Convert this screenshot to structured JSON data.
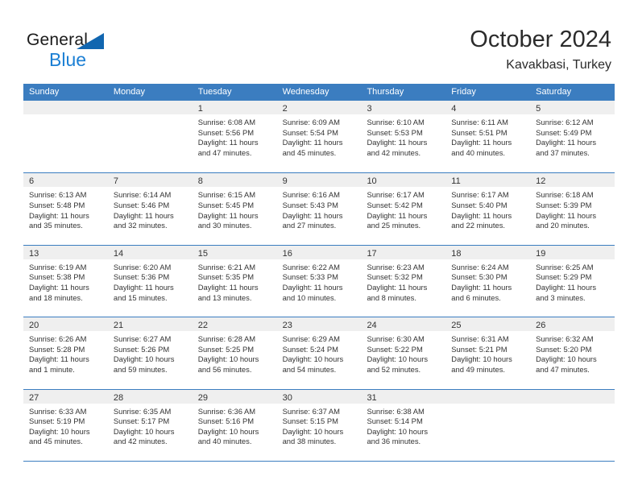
{
  "brand": {
    "word_one": "General",
    "word_two": "Blue",
    "triangle_color": "#1166b0",
    "blue_text_color": "#1b7fd4"
  },
  "header": {
    "title": "October 2024",
    "subtitle": "Kavakbasi, Turkey"
  },
  "theme": {
    "header_bar_color": "#3b7dc0",
    "day_band_color": "#efefef",
    "text_color": "#333333"
  },
  "calendar": {
    "weekdays": [
      "Sunday",
      "Monday",
      "Tuesday",
      "Wednesday",
      "Thursday",
      "Friday",
      "Saturday"
    ],
    "weeks": [
      [
        {
          "day": "",
          "sunrise": "",
          "sunset": "",
          "daylight_line1": "",
          "daylight_line2": ""
        },
        {
          "day": "",
          "sunrise": "",
          "sunset": "",
          "daylight_line1": "",
          "daylight_line2": ""
        },
        {
          "day": "1",
          "sunrise": "Sunrise: 6:08 AM",
          "sunset": "Sunset: 5:56 PM",
          "daylight_line1": "Daylight: 11 hours",
          "daylight_line2": "and 47 minutes."
        },
        {
          "day": "2",
          "sunrise": "Sunrise: 6:09 AM",
          "sunset": "Sunset: 5:54 PM",
          "daylight_line1": "Daylight: 11 hours",
          "daylight_line2": "and 45 minutes."
        },
        {
          "day": "3",
          "sunrise": "Sunrise: 6:10 AM",
          "sunset": "Sunset: 5:53 PM",
          "daylight_line1": "Daylight: 11 hours",
          "daylight_line2": "and 42 minutes."
        },
        {
          "day": "4",
          "sunrise": "Sunrise: 6:11 AM",
          "sunset": "Sunset: 5:51 PM",
          "daylight_line1": "Daylight: 11 hours",
          "daylight_line2": "and 40 minutes."
        },
        {
          "day": "5",
          "sunrise": "Sunrise: 6:12 AM",
          "sunset": "Sunset: 5:49 PM",
          "daylight_line1": "Daylight: 11 hours",
          "daylight_line2": "and 37 minutes."
        }
      ],
      [
        {
          "day": "6",
          "sunrise": "Sunrise: 6:13 AM",
          "sunset": "Sunset: 5:48 PM",
          "daylight_line1": "Daylight: 11 hours",
          "daylight_line2": "and 35 minutes."
        },
        {
          "day": "7",
          "sunrise": "Sunrise: 6:14 AM",
          "sunset": "Sunset: 5:46 PM",
          "daylight_line1": "Daylight: 11 hours",
          "daylight_line2": "and 32 minutes."
        },
        {
          "day": "8",
          "sunrise": "Sunrise: 6:15 AM",
          "sunset": "Sunset: 5:45 PM",
          "daylight_line1": "Daylight: 11 hours",
          "daylight_line2": "and 30 minutes."
        },
        {
          "day": "9",
          "sunrise": "Sunrise: 6:16 AM",
          "sunset": "Sunset: 5:43 PM",
          "daylight_line1": "Daylight: 11 hours",
          "daylight_line2": "and 27 minutes."
        },
        {
          "day": "10",
          "sunrise": "Sunrise: 6:17 AM",
          "sunset": "Sunset: 5:42 PM",
          "daylight_line1": "Daylight: 11 hours",
          "daylight_line2": "and 25 minutes."
        },
        {
          "day": "11",
          "sunrise": "Sunrise: 6:17 AM",
          "sunset": "Sunset: 5:40 PM",
          "daylight_line1": "Daylight: 11 hours",
          "daylight_line2": "and 22 minutes."
        },
        {
          "day": "12",
          "sunrise": "Sunrise: 6:18 AM",
          "sunset": "Sunset: 5:39 PM",
          "daylight_line1": "Daylight: 11 hours",
          "daylight_line2": "and 20 minutes."
        }
      ],
      [
        {
          "day": "13",
          "sunrise": "Sunrise: 6:19 AM",
          "sunset": "Sunset: 5:38 PM",
          "daylight_line1": "Daylight: 11 hours",
          "daylight_line2": "and 18 minutes."
        },
        {
          "day": "14",
          "sunrise": "Sunrise: 6:20 AM",
          "sunset": "Sunset: 5:36 PM",
          "daylight_line1": "Daylight: 11 hours",
          "daylight_line2": "and 15 minutes."
        },
        {
          "day": "15",
          "sunrise": "Sunrise: 6:21 AM",
          "sunset": "Sunset: 5:35 PM",
          "daylight_line1": "Daylight: 11 hours",
          "daylight_line2": "and 13 minutes."
        },
        {
          "day": "16",
          "sunrise": "Sunrise: 6:22 AM",
          "sunset": "Sunset: 5:33 PM",
          "daylight_line1": "Daylight: 11 hours",
          "daylight_line2": "and 10 minutes."
        },
        {
          "day": "17",
          "sunrise": "Sunrise: 6:23 AM",
          "sunset": "Sunset: 5:32 PM",
          "daylight_line1": "Daylight: 11 hours",
          "daylight_line2": "and 8 minutes."
        },
        {
          "day": "18",
          "sunrise": "Sunrise: 6:24 AM",
          "sunset": "Sunset: 5:30 PM",
          "daylight_line1": "Daylight: 11 hours",
          "daylight_line2": "and 6 minutes."
        },
        {
          "day": "19",
          "sunrise": "Sunrise: 6:25 AM",
          "sunset": "Sunset: 5:29 PM",
          "daylight_line1": "Daylight: 11 hours",
          "daylight_line2": "and 3 minutes."
        }
      ],
      [
        {
          "day": "20",
          "sunrise": "Sunrise: 6:26 AM",
          "sunset": "Sunset: 5:28 PM",
          "daylight_line1": "Daylight: 11 hours",
          "daylight_line2": "and 1 minute."
        },
        {
          "day": "21",
          "sunrise": "Sunrise: 6:27 AM",
          "sunset": "Sunset: 5:26 PM",
          "daylight_line1": "Daylight: 10 hours",
          "daylight_line2": "and 59 minutes."
        },
        {
          "day": "22",
          "sunrise": "Sunrise: 6:28 AM",
          "sunset": "Sunset: 5:25 PM",
          "daylight_line1": "Daylight: 10 hours",
          "daylight_line2": "and 56 minutes."
        },
        {
          "day": "23",
          "sunrise": "Sunrise: 6:29 AM",
          "sunset": "Sunset: 5:24 PM",
          "daylight_line1": "Daylight: 10 hours",
          "daylight_line2": "and 54 minutes."
        },
        {
          "day": "24",
          "sunrise": "Sunrise: 6:30 AM",
          "sunset": "Sunset: 5:22 PM",
          "daylight_line1": "Daylight: 10 hours",
          "daylight_line2": "and 52 minutes."
        },
        {
          "day": "25",
          "sunrise": "Sunrise: 6:31 AM",
          "sunset": "Sunset: 5:21 PM",
          "daylight_line1": "Daylight: 10 hours",
          "daylight_line2": "and 49 minutes."
        },
        {
          "day": "26",
          "sunrise": "Sunrise: 6:32 AM",
          "sunset": "Sunset: 5:20 PM",
          "daylight_line1": "Daylight: 10 hours",
          "daylight_line2": "and 47 minutes."
        }
      ],
      [
        {
          "day": "27",
          "sunrise": "Sunrise: 6:33 AM",
          "sunset": "Sunset: 5:19 PM",
          "daylight_line1": "Daylight: 10 hours",
          "daylight_line2": "and 45 minutes."
        },
        {
          "day": "28",
          "sunrise": "Sunrise: 6:35 AM",
          "sunset": "Sunset: 5:17 PM",
          "daylight_line1": "Daylight: 10 hours",
          "daylight_line2": "and 42 minutes."
        },
        {
          "day": "29",
          "sunrise": "Sunrise: 6:36 AM",
          "sunset": "Sunset: 5:16 PM",
          "daylight_line1": "Daylight: 10 hours",
          "daylight_line2": "and 40 minutes."
        },
        {
          "day": "30",
          "sunrise": "Sunrise: 6:37 AM",
          "sunset": "Sunset: 5:15 PM",
          "daylight_line1": "Daylight: 10 hours",
          "daylight_line2": "and 38 minutes."
        },
        {
          "day": "31",
          "sunrise": "Sunrise: 6:38 AM",
          "sunset": "Sunset: 5:14 PM",
          "daylight_line1": "Daylight: 10 hours",
          "daylight_line2": "and 36 minutes."
        },
        {
          "day": "",
          "sunrise": "",
          "sunset": "",
          "daylight_line1": "",
          "daylight_line2": ""
        },
        {
          "day": "",
          "sunrise": "",
          "sunset": "",
          "daylight_line1": "",
          "daylight_line2": ""
        }
      ]
    ]
  }
}
